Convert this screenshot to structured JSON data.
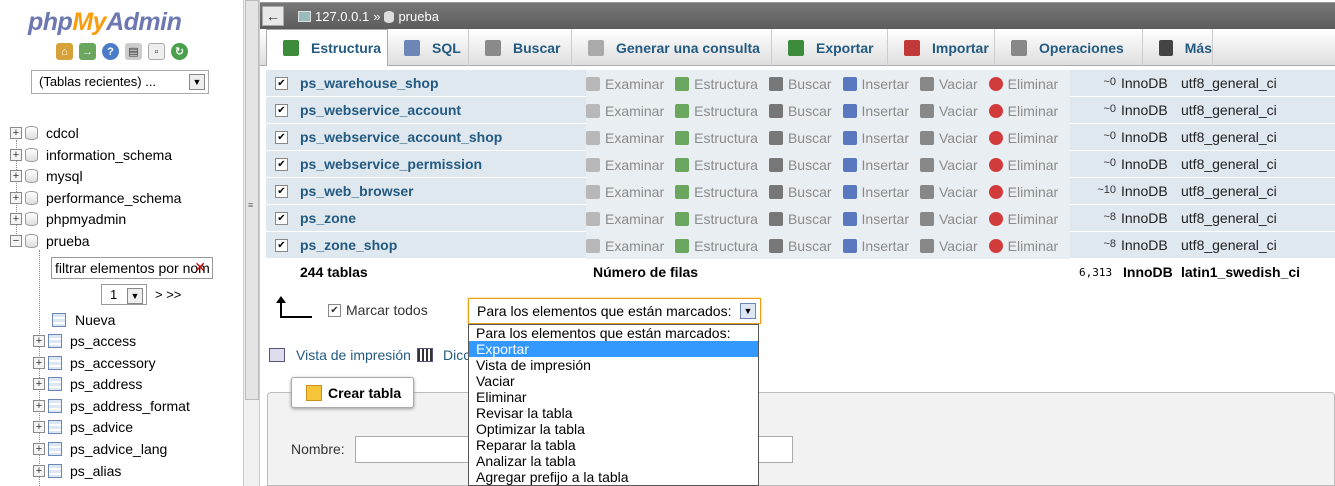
{
  "nav": {
    "logo_php": "php",
    "logo_my": "My",
    "logo_admin": "Admin",
    "recent_select": "(Tablas recientes) ...",
    "databases": [
      "cdcol",
      "information_schema",
      "mysql",
      "performance_schema",
      "phpmyadmin",
      "prueba"
    ],
    "filter_value": "filtrar elementos por nom",
    "page_value": "1",
    "page_next": "> >>",
    "new_item": "Nueva",
    "tables": [
      "ps_access",
      "ps_accessory",
      "ps_address",
      "ps_address_format",
      "ps_advice",
      "ps_advice_lang",
      "ps_alias"
    ]
  },
  "topbar": {
    "back": "←",
    "server": "127.0.0.1",
    "sep": "»",
    "database": "prueba"
  },
  "tabs": [
    {
      "label": "Estructura",
      "color": "#3c8c3c"
    },
    {
      "label": "SQL",
      "color": "#6d86b6"
    },
    {
      "label": "Buscar",
      "color": "#8a8a8a"
    },
    {
      "label": "Generar una consulta",
      "color": "#aaaaaa"
    },
    {
      "label": "Exportar",
      "color": "#3c8c3c"
    },
    {
      "label": "Importar",
      "color": "#c03838"
    },
    {
      "label": "Operaciones",
      "color": "#888888"
    },
    {
      "label": "Más",
      "color": "#444444"
    }
  ],
  "actions": [
    "Examinar",
    "Estructura",
    "Buscar",
    "Insertar",
    "Vaciar",
    "Eliminar"
  ],
  "rows": [
    {
      "name": "ps_warehouse_shop",
      "rows": "~0",
      "engine": "InnoDB",
      "collation": "utf8_general_ci"
    },
    {
      "name": "ps_webservice_account",
      "rows": "~0",
      "engine": "InnoDB",
      "collation": "utf8_general_ci"
    },
    {
      "name": "ps_webservice_account_shop",
      "rows": "~0",
      "engine": "InnoDB",
      "collation": "utf8_general_ci"
    },
    {
      "name": "ps_webservice_permission",
      "rows": "~0",
      "engine": "InnoDB",
      "collation": "utf8_general_ci"
    },
    {
      "name": "ps_web_browser",
      "rows": "~10",
      "engine": "InnoDB",
      "collation": "utf8_general_ci"
    },
    {
      "name": "ps_zone",
      "rows": "~8",
      "engine": "InnoDB",
      "collation": "utf8_general_ci"
    },
    {
      "name": "ps_zone_shop",
      "rows": "~8",
      "engine": "InnoDB",
      "collation": "utf8_general_ci"
    }
  ],
  "summary": {
    "tables": "244 tablas",
    "rows_label": "Número de filas",
    "rows": "6,313",
    "engine": "InnoDB",
    "collation": "latin1_swedish_ci"
  },
  "bulk": {
    "check_all": "Marcar todos",
    "select_value": "Para los elementos que están marcados:",
    "options": [
      "Para los elementos que están marcados:",
      "Exportar",
      "Vista de impresión",
      "Vaciar",
      "Eliminar",
      "Revisar la tabla",
      "Optimizar la tabla",
      "Reparar la tabla",
      "Analizar la tabla",
      "Agregar prefijo a la tabla"
    ],
    "selected_index": 1
  },
  "links": {
    "print_view": "Vista de impresión",
    "dictionary": "Dicc"
  },
  "create": {
    "button": "Crear tabla",
    "name_label": "Nombre:"
  }
}
